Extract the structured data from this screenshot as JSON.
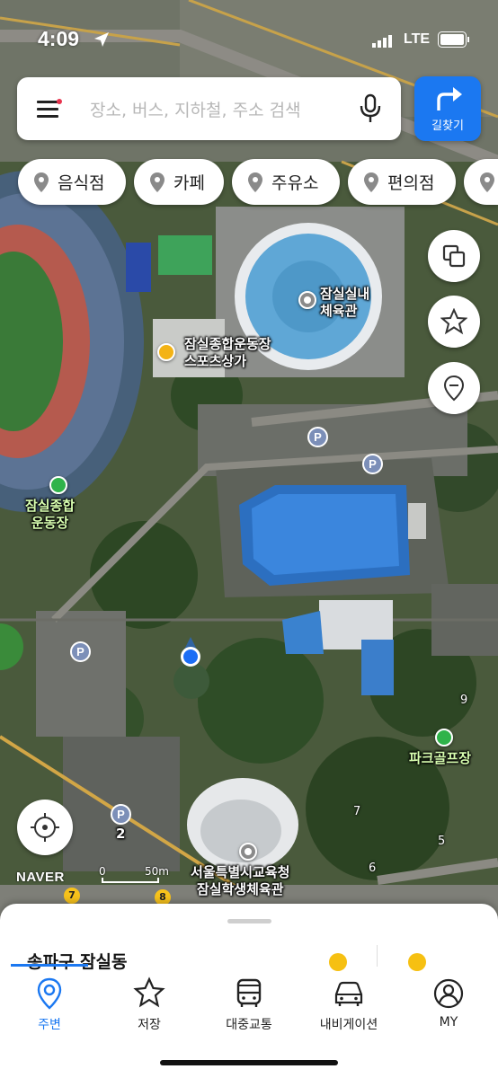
{
  "status_bar": {
    "time": "4:09",
    "network": "LTE"
  },
  "search": {
    "placeholder": "장소, 버스, 지하철, 주소 검색"
  },
  "route_button": {
    "label": "길찾기"
  },
  "categories": [
    "음식점",
    "카페",
    "주유소",
    "편의점"
  ],
  "map_labels": {
    "arena": [
      "잠실실내",
      "체육관"
    ],
    "sports_mall": [
      "잠실종합운동장",
      "스포츠상가"
    ],
    "stadium": [
      "잠실종합",
      "운동장"
    ],
    "park_golf": "파크골프장",
    "student_gym": [
      "서울특별시교육청",
      "잠실학생체육관"
    ]
  },
  "parking": {
    "symbol": "P",
    "lot_count": "2"
  },
  "road_numbers": [
    "9",
    "7",
    "5",
    "6",
    "7",
    "8"
  ],
  "map_brand": "NAVER",
  "scale": {
    "start": "0",
    "end": "50m"
  },
  "sheet": {
    "region": "송파구 잠실동"
  },
  "tabs": [
    {
      "label": "주변",
      "icon": "location-pin-icon",
      "active": true
    },
    {
      "label": "저장",
      "icon": "star-icon",
      "active": false
    },
    {
      "label": "대중교통",
      "icon": "bus-icon",
      "active": false
    },
    {
      "label": "내비게이션",
      "icon": "car-icon",
      "active": false
    },
    {
      "label": "MY",
      "icon": "user-icon",
      "active": false
    }
  ],
  "colors": {
    "accent": "#1b78f1",
    "parking": "#7c8fb8",
    "location_dot": "#1b6ef5"
  }
}
